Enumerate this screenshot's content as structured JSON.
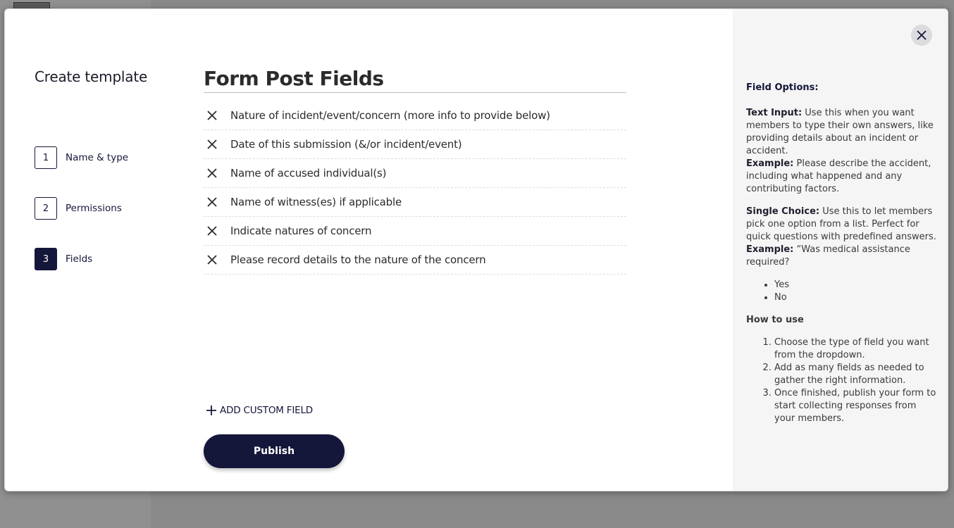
{
  "wizard": {
    "title": "Create template",
    "steps": [
      {
        "num": "1",
        "label": "Name & type"
      },
      {
        "num": "2",
        "label": "Permissions"
      },
      {
        "num": "3",
        "label": "Fields"
      }
    ],
    "active_step": "3"
  },
  "form": {
    "title": "Form Post Fields",
    "fields": [
      "Nature of incident/event/concern (more info to provide below)",
      "Date of this submission (&/or incident/event)",
      "Name of accused individual(s)",
      "Name of witness(es) if applicable",
      "Indicate natures of concern",
      "Please record details to the nature of the concern"
    ],
    "add_field_label": "ADD CUSTOM FIELD",
    "publish_label": "Publish"
  },
  "help": {
    "heading": "Field Options:",
    "text_input_title": "Text Input:",
    "text_input_desc": "Use this when you want members to type their own answers, like providing details about an incident or accident.",
    "text_input_example_label": "Example:",
    "text_input_example": "Please describe the accident, including what happened and any contributing factors.",
    "single_choice_title": "Single Choice:",
    "single_choice_desc": "Use this to let members pick one option from a list. Perfect for quick questions with predefined answers.",
    "single_choice_example_label": "Example:",
    "single_choice_example": "“Was medical assistance required?",
    "choice_options": [
      "Yes",
      "No"
    ],
    "how_to_title": "How to use",
    "how_to_steps": [
      "Choose the type of field you want from the dropdown.",
      "Add as many fields as needed to gather the right information.",
      "Once finished, publish your form to start collecting responses from your members."
    ]
  },
  "icons": {
    "close": "close-icon",
    "remove": "x-icon",
    "add": "plus-icon"
  },
  "colors": {
    "accent": "#14163a",
    "side_panel": "#f5f5f5"
  }
}
